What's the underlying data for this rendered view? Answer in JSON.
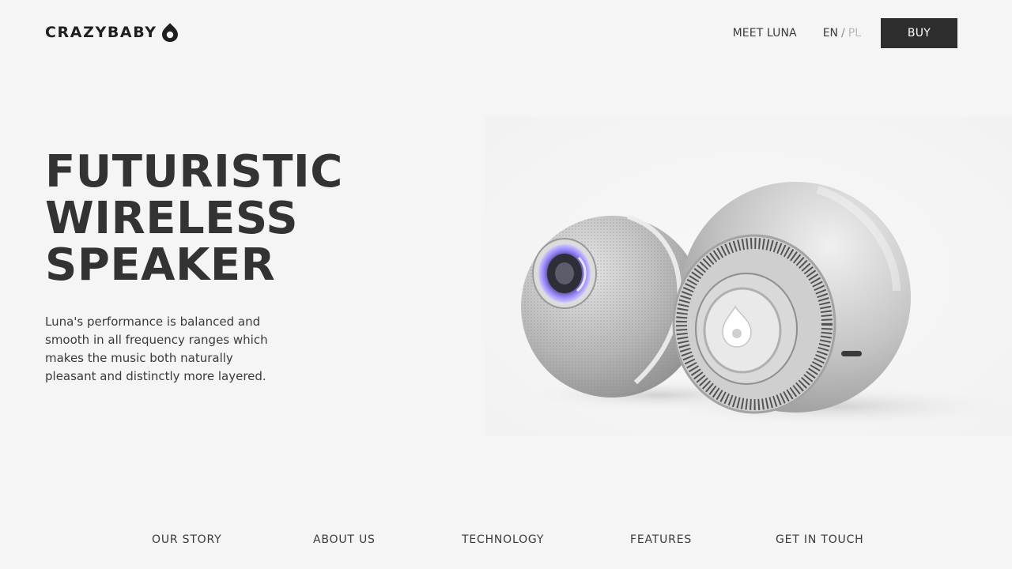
{
  "brand": {
    "name": "CRAZYBABY",
    "logo_icon": "drop-ring-icon"
  },
  "header": {
    "meet_label": "MEET LUNA",
    "lang_en": "EN",
    "lang_separator": "/",
    "lang_pl": "PL",
    "buy_label": "BUY"
  },
  "hero": {
    "title_lines": [
      "FUTURISTIC",
      "WIRELESS",
      "SPEAKER"
    ],
    "description": "Luna's performance is balanced and smooth in all frequency ranges which makes the music both naturally pleasant and distinctly more layered.",
    "image_icon": "speaker-pair-image"
  },
  "footer_nav": [
    {
      "label": "OUR STORY"
    },
    {
      "label": "ABOUT US"
    },
    {
      "label": "TECHNOLOGY"
    },
    {
      "label": "FEATURES"
    },
    {
      "label": "GET IN TOUCH"
    }
  ],
  "colors": {
    "background": "#f5f5f5",
    "text": "#333333",
    "button_bg": "#2d2d2d",
    "button_text": "#ffffff",
    "muted": "#b8b8b8",
    "accent_glow": "#7b6cf2"
  }
}
